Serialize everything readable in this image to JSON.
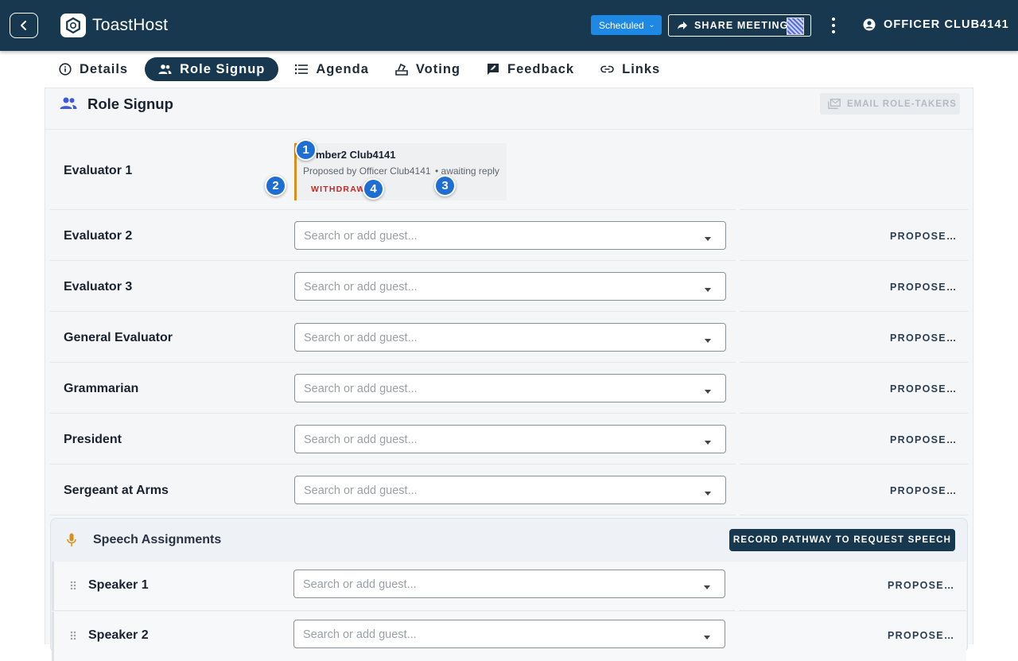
{
  "app": {
    "title": "ToastHost"
  },
  "header": {
    "status_label": "Scheduled",
    "share_label": "SHARE MEETING",
    "user_name": "OFFICER CLUB4141"
  },
  "tabs": [
    {
      "label": "Details",
      "icon": "info-icon"
    },
    {
      "label": "Role Signup",
      "icon": "people-icon",
      "active": true
    },
    {
      "label": "Agenda",
      "icon": "list-icon"
    },
    {
      "label": "Voting",
      "icon": "vote-icon"
    },
    {
      "label": "Feedback",
      "icon": "feedback-icon"
    },
    {
      "label": "Links",
      "icon": "link-icon"
    }
  ],
  "section": {
    "title": "Role Signup",
    "email_label": "EMAIL ROLE-TAKERS"
  },
  "evaluator1": {
    "role": "Evaluator 1",
    "member": "Member2 Club4141",
    "member_visible": "mber2 Club4141",
    "proposed_by": "Proposed by Officer Club4141",
    "status": "• awaiting reply",
    "withdraw_label": "WITHDRAW"
  },
  "roles": [
    {
      "name": "Evaluator 2",
      "placeholder": "Search or add guest...",
      "action": "PROPOSE…"
    },
    {
      "name": "Evaluator 3",
      "placeholder": "Search or add guest...",
      "action": "PROPOSE…"
    },
    {
      "name": "General Evaluator",
      "placeholder": "Search or add guest...",
      "action": "PROPOSE…"
    },
    {
      "name": "Grammarian",
      "placeholder": "Search or add guest...",
      "action": "PROPOSE…"
    },
    {
      "name": "President",
      "placeholder": "Search or add guest...",
      "action": "PROPOSE…"
    },
    {
      "name": "Sergeant at Arms",
      "placeholder": "Search or add guest...",
      "action": "PROPOSE…"
    }
  ],
  "speech": {
    "title": "Speech Assignments",
    "record_label": "RECORD PATHWAY TO REQUEST SPEECH",
    "speakers": [
      {
        "name": "Speaker 1",
        "placeholder": "Search or add guest...",
        "action": "PROPOSE…"
      },
      {
        "name": "Speaker 2",
        "placeholder": "Search or add guest...",
        "action": "PROPOSE…"
      }
    ]
  },
  "markers": [
    "1",
    "2",
    "3",
    "4"
  ],
  "colors": {
    "header_bg": "#17384f",
    "status_blue": "#1e88e5",
    "pending_accent": "#d9901a",
    "withdraw_red": "#c62828",
    "marker_blue": "#1e6fd1"
  }
}
